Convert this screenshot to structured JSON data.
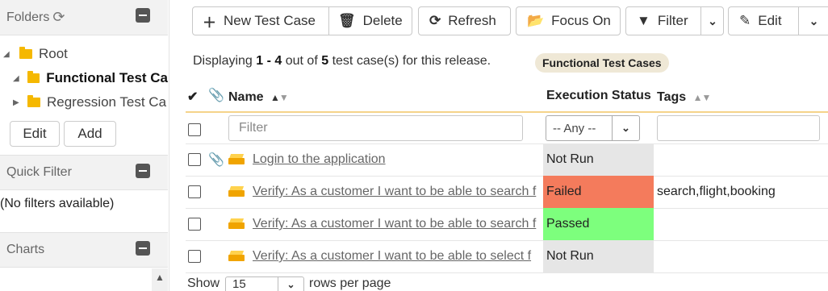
{
  "sidebar": {
    "folders_panel": {
      "title": "Folders",
      "refresh_icon": "refresh-icon",
      "collapse_icon": "minus-square-icon"
    },
    "tree": [
      {
        "label": "Root",
        "expanded": true,
        "bold": false
      },
      {
        "label": "Functional Test Ca",
        "expanded": true,
        "bold": true
      },
      {
        "label": "Regression Test Ca",
        "expanded": false,
        "bold": false
      }
    ],
    "edit_label": "Edit",
    "add_label": "Add",
    "quick_filter_panel": {
      "title": "Quick Filter",
      "empty_text": "(No filters available)"
    },
    "charts_panel": {
      "title": "Charts"
    }
  },
  "toolbar": {
    "new_test_case": "New Test Case",
    "delete": "Delete",
    "refresh": "Refresh",
    "focus_on": "Focus On",
    "filter": "Filter",
    "edit": "Edit"
  },
  "info": {
    "prefix": "Displaying",
    "range": "1 - 4",
    "middle": "out of",
    "total": "5",
    "suffix": "test case(s) for this release.",
    "badge": "Functional Test Cases"
  },
  "grid": {
    "columns": {
      "name": "Name",
      "execution_status": "Execution Status",
      "tags": "Tags"
    },
    "filter_placeholder": "Filter",
    "status_filter_value": "-- Any --",
    "rows": [
      {
        "name": "Login to the application",
        "has_attachment": true,
        "status": "Not Run",
        "status_color": "#e6e6e6",
        "tags": ""
      },
      {
        "name": "Verify: As a customer I want to be able to search f",
        "has_attachment": false,
        "status": "Failed",
        "status_color": "#f47b5c",
        "tags": "search,flight,booking"
      },
      {
        "name": "Verify: As a customer I want to be able to search f",
        "has_attachment": false,
        "status": "Passed",
        "status_color": "#7dff7d",
        "tags": ""
      },
      {
        "name": "Verify: As a customer I want to be able to select f",
        "has_attachment": false,
        "status": "Not Run",
        "status_color": "#e6e6e6",
        "tags": ""
      }
    ]
  },
  "footer": {
    "show_label": "Show",
    "page_size": "15",
    "rows_per_page": "rows per page"
  }
}
